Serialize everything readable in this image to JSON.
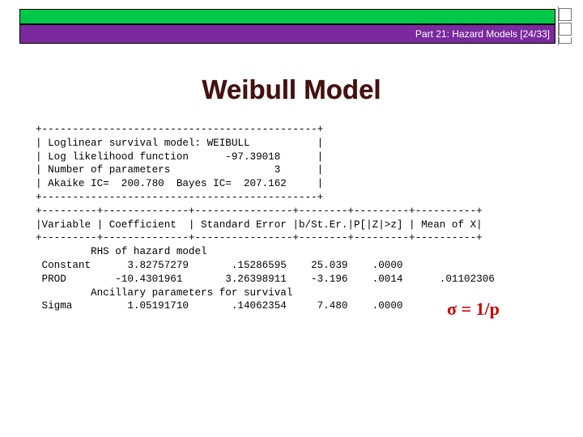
{
  "header": {
    "slide_label": "Part 21: Hazard Models [24/33]"
  },
  "slide": {
    "title": "Weibull Model",
    "output_lines": [
      "+---------------------------------------------+",
      "| Loglinear survival model: WEIBULL           |",
      "| Log likelihood function      -97.39018      |",
      "| Number of parameters                 3      |",
      "| Akaike IC=  200.780  Bayes IC=  207.162     |",
      "+---------------------------------------------+",
      "+---------+--------------+----------------+--------+---------+----------+",
      "|Variable | Coefficient  | Standard Error |b/St.Er.|P[|Z|>z] | Mean of X|",
      "+---------+--------------+----------------+--------+---------+----------+",
      "         RHS of hazard model",
      " Constant      3.82757279       .15286595    25.039    .0000",
      " PROD        -10.4301961       3.26398911    -3.196    .0014      .01102306",
      "         Ancillary parameters for survival",
      " Sigma         1.05191710       .14062354     7.480    .0000"
    ],
    "formula": "σ = 1/p"
  },
  "colors": {
    "header_green": "#00c84b",
    "header_purple": "#7a2a9e",
    "title": "#4a0f0f",
    "formula": "#cc0000"
  }
}
